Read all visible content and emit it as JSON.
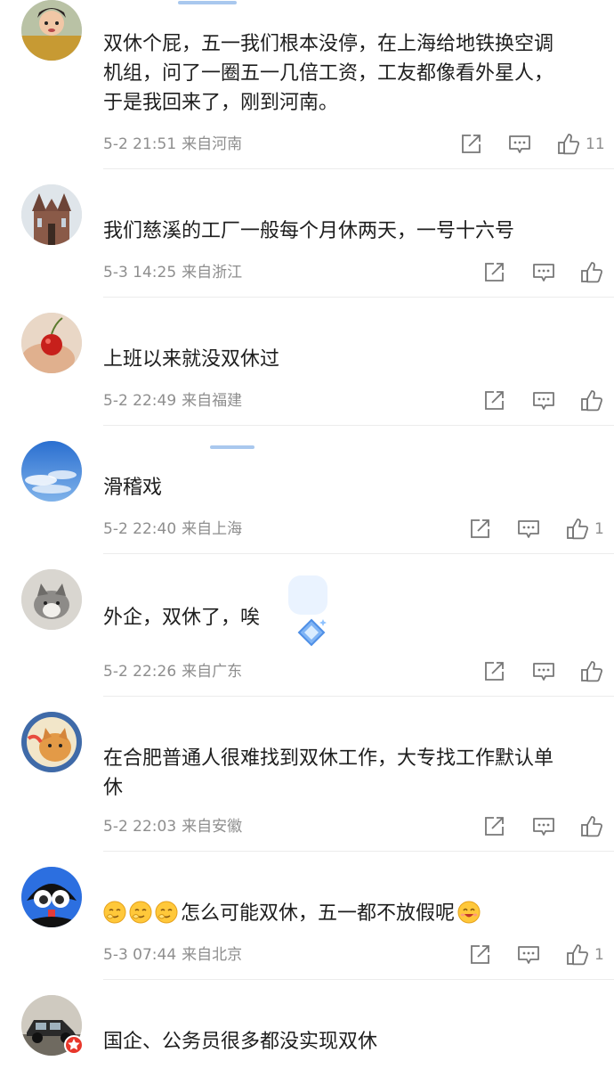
{
  "colors": {
    "meta": "#8e8e8e",
    "text": "#1e1e1e",
    "divider": "#ececec",
    "badge_red": "#e8372b"
  },
  "comments": [
    {
      "avatar_icon": "costume-woman-avatar",
      "user": "",
      "lines": [
        "双休个屁，五一我们根本没停，在上海给地铁换空调",
        "机组，问了一圈五一几倍工资，工友都像看外星人，",
        "于是我回来了，刚到河南。"
      ],
      "time": "5-2 21:51",
      "location": "来自河南",
      "likes": "11"
    },
    {
      "avatar_icon": "church-avatar",
      "user": "",
      "lines": [
        "我们慈溪的工厂一般每个月休两天，一号十六号"
      ],
      "time": "5-3 14:25",
      "location": "来自浙江",
      "likes": ""
    },
    {
      "avatar_icon": "cherry-hand-avatar",
      "user": "",
      "lines": [
        "上班以来就没双休过"
      ],
      "time": "5-2 22:49",
      "location": "来自福建",
      "likes": ""
    },
    {
      "avatar_icon": "blue-sky-avatar",
      "user": "",
      "lines": [
        "滑稽戏"
      ],
      "time": "5-2 22:40",
      "location": "来自上海",
      "likes": "1"
    },
    {
      "avatar_icon": "kitten-avatar",
      "user": "",
      "lines": [
        "外企，双休了，唉"
      ],
      "time": "5-2 22:26",
      "location": "来自广东",
      "likes": ""
    },
    {
      "avatar_icon": "orange-cat-avatar",
      "user": "",
      "lines": [
        "在合肥普通人很难找到双休工作，大专找工作默认单",
        "休"
      ],
      "time": "5-2 22:03",
      "location": "来自安徽",
      "likes": ""
    },
    {
      "avatar_icon": "cartoon-girl-avatar",
      "user": "",
      "lines": [
        "怎么可能双休，五一都不放假呢"
      ],
      "time": "5-3 07:44",
      "location": "来自北京",
      "likes": "1"
    },
    {
      "avatar_icon": "vintage-car-avatar",
      "user": "",
      "lines": [
        "国企、公务员很多都没实现双休"
      ],
      "time": "",
      "location": "",
      "likes": ""
    }
  ]
}
